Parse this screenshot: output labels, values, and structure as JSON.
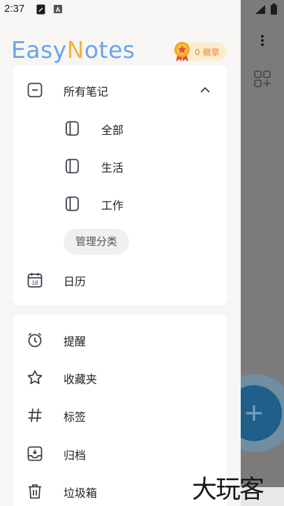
{
  "status_bar": {
    "time": "2:37",
    "icons": [
      "note-icon",
      "text-a-icon",
      "signal-icon",
      "battery-icon"
    ]
  },
  "drawer": {
    "logo": {
      "part1": "Easy",
      "part2": "N",
      "part3": "otes"
    },
    "badge": {
      "label": "0 徽章",
      "icon": "medal-icon"
    },
    "notes_section": {
      "header": "所有笔记",
      "expanded": true,
      "categories": [
        {
          "label": "全部",
          "icon": "notebook-icon"
        },
        {
          "label": "生活",
          "icon": "notebook-icon"
        },
        {
          "label": "工作",
          "icon": "notebook-icon"
        }
      ],
      "manage_label": "管理分类",
      "calendar_label": "日历",
      "calendar_day": "18"
    },
    "tools_section": [
      {
        "label": "提醒",
        "icon": "alarm-clock-icon"
      },
      {
        "label": "收藏夹",
        "icon": "star-icon"
      },
      {
        "label": "标签",
        "icon": "hashtag-icon"
      },
      {
        "label": "归档",
        "icon": "archive-icon"
      },
      {
        "label": "垃圾箱",
        "icon": "trash-icon"
      }
    ]
  },
  "background": {
    "fab_icon": "plus-icon",
    "more_icon": "more-vertical-icon",
    "grid_icon": "grid-add-icon"
  },
  "watermark": "大玩客",
  "colors": {
    "logo_blue": "#6aa3ea",
    "logo_orange": "#f2b43a",
    "badge_bg": "#fbeccd",
    "badge_text": "#e68a38",
    "icon_color": "#3b3f4a"
  }
}
